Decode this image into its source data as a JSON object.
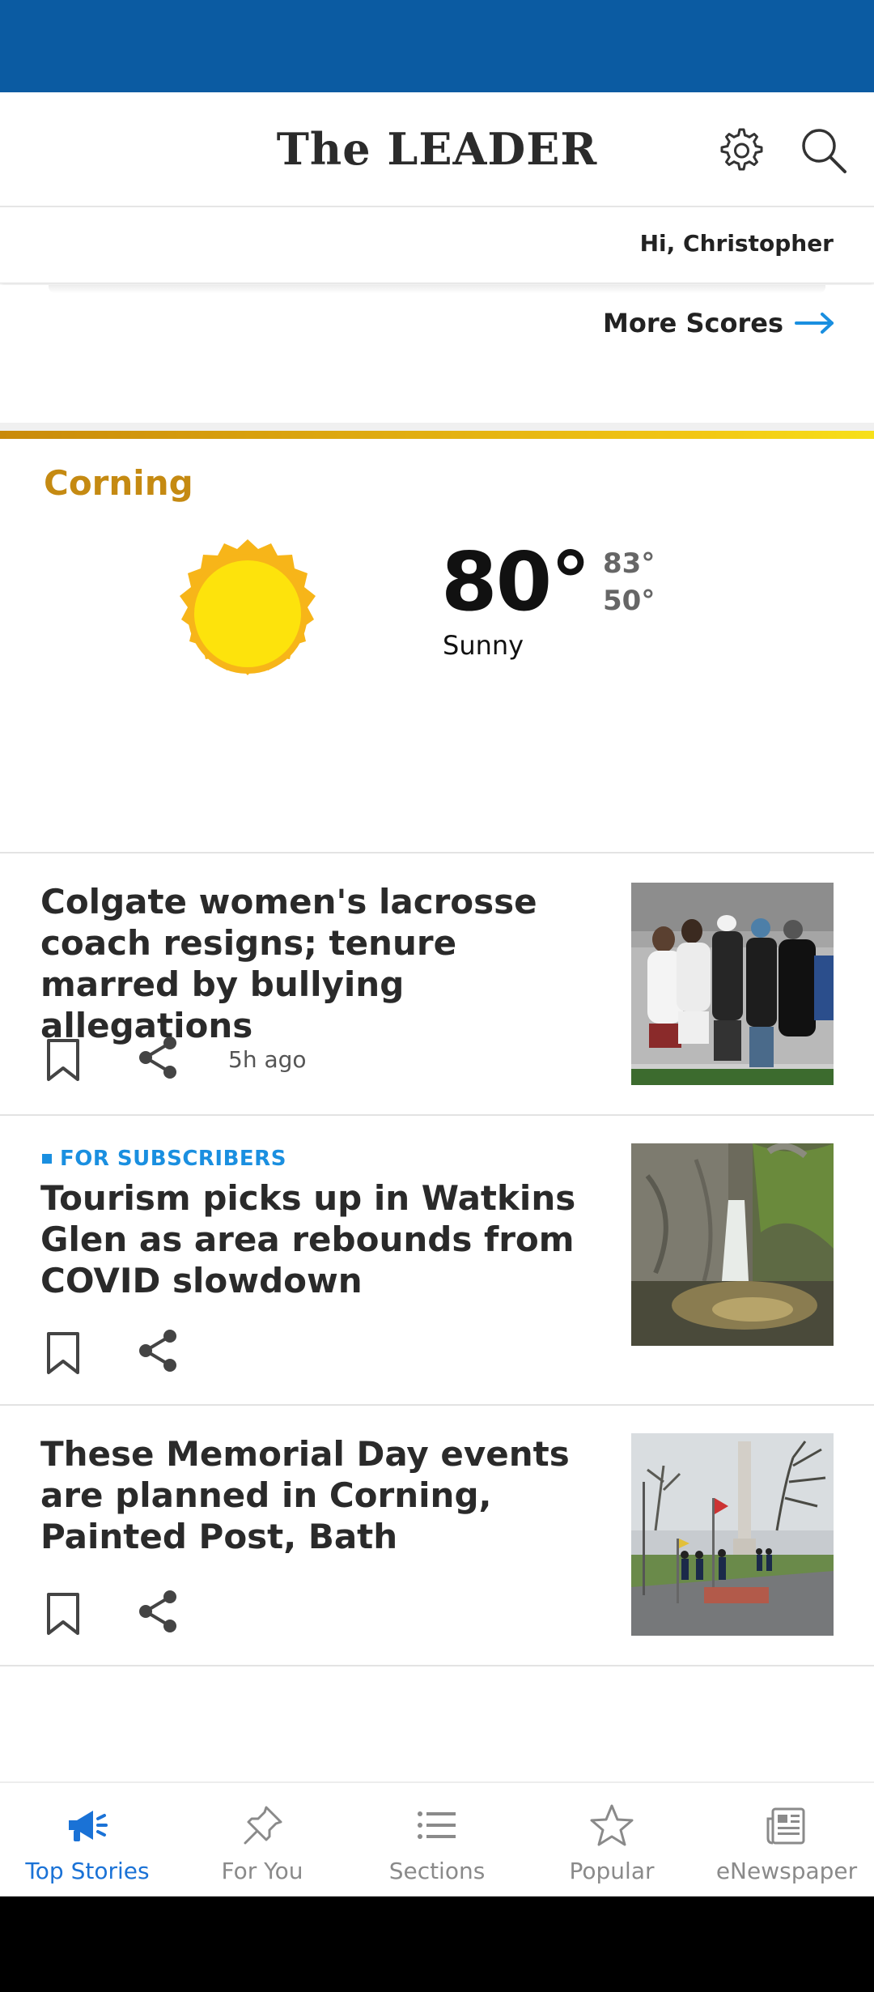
{
  "header": {
    "logo": "The LEADER"
  },
  "greeting": "Hi, Christopher",
  "scores": {
    "more_label": "More Scores"
  },
  "weather": {
    "city": "Corning",
    "temp": "80°",
    "high": "83°",
    "low": "50°",
    "condition": "Sunny"
  },
  "stories": [
    {
      "headline": "Colgate women's lacrosse coach resigns; tenure marred by bullying allegations",
      "time": "5h ago",
      "badge": ""
    },
    {
      "headline": "Tourism picks up in Watkins Glen as area rebounds from COVID slowdown",
      "time": "",
      "badge": "FOR SUBSCRIBERS"
    },
    {
      "headline": "These Memorial Day events are planned in Corning, Painted Post, Bath",
      "time": "",
      "badge": ""
    }
  ],
  "nav": [
    {
      "label": "Top Stories",
      "icon": "megaphone-icon",
      "active": true
    },
    {
      "label": "For You",
      "icon": "pin-icon",
      "active": false
    },
    {
      "label": "Sections",
      "icon": "list-icon",
      "active": false
    },
    {
      "label": "Popular",
      "icon": "star-icon",
      "active": false
    },
    {
      "label": "eNewspaper",
      "icon": "newspaper-icon",
      "active": false
    }
  ],
  "colors": {
    "brand_blue": "#0b5ba2",
    "accent_gold": "#c58a12",
    "link_blue": "#1a8fe0",
    "active_nav": "#1a72d6"
  }
}
